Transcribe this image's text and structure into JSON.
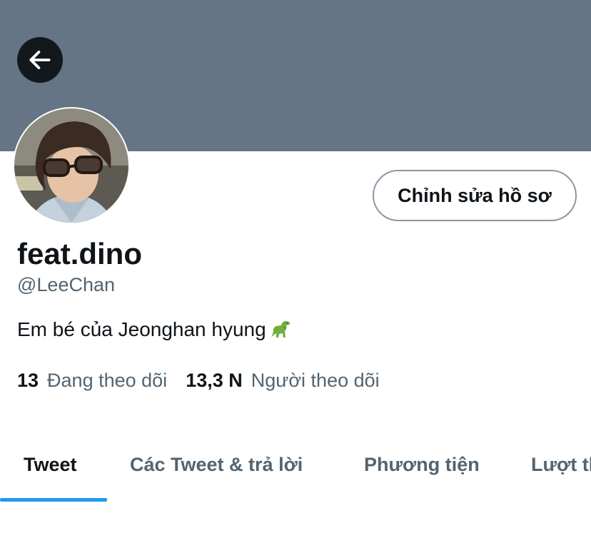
{
  "header": {
    "banner_color": "#657586",
    "back_icon": "arrow-left-icon"
  },
  "profile": {
    "display_name": "feat.dino",
    "handle": "@LeeChan",
    "bio": "Em bé của Jeonghan hyung",
    "bio_emoji_icon": "t-rex-icon",
    "edit_button_label": "Chỉnh sửa hồ sơ",
    "avatar_icon": "profile-photo"
  },
  "stats": {
    "following_count": "13",
    "following_label": "Đang theo dõi",
    "followers_count": "13,3 N",
    "followers_label": "Người theo dõi"
  },
  "tabs": [
    {
      "label": "Tweet",
      "active": true
    },
    {
      "label": "Các Tweet & trả lời",
      "active": false
    },
    {
      "label": "Phương tiện",
      "active": false
    },
    {
      "label": "Lượt thích",
      "active": false
    }
  ],
  "colors": {
    "accent": "#1d9bf0",
    "primary_text": "#0f1419",
    "secondary_text": "#536471"
  }
}
